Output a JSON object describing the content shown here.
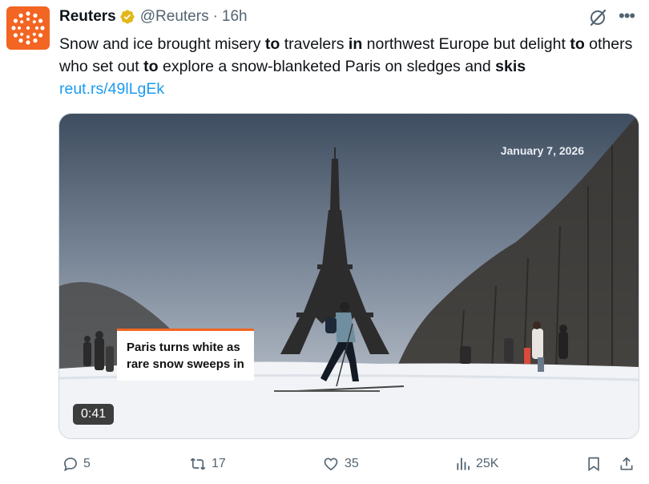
{
  "account": {
    "name": "Reuters",
    "handle": "@Reuters",
    "separator": "·",
    "time": "16h"
  },
  "tweet": {
    "text_parts": [
      {
        "t": "Snow and ice brought misery ",
        "b": false
      },
      {
        "t": "to",
        "b": true
      },
      {
        "t": " travelers ",
        "b": false
      },
      {
        "t": "in",
        "b": true
      },
      {
        "t": " northwest Europe but delight ",
        "b": false
      },
      {
        "t": "to",
        "b": true
      },
      {
        "t": " others who set out ",
        "b": false
      },
      {
        "t": "to",
        "b": true
      },
      {
        "t": " explore a snow-blanketed Paris on sledges and ",
        "b": false
      },
      {
        "t": "skis",
        "b": true
      }
    ],
    "link": "reut.rs/49lLgEk"
  },
  "media": {
    "date_overlay": "January 7, 2026",
    "caption_line1": "Paris turns white as",
    "caption_line2": "rare snow sweeps in",
    "duration": "0:41"
  },
  "actions": {
    "replies": "5",
    "reposts": "17",
    "likes": "35",
    "views": "25K"
  },
  "colors": {
    "brand": "#f26522",
    "verified": "#e2b719",
    "link": "#1d9bf0",
    "muted": "#536471"
  }
}
